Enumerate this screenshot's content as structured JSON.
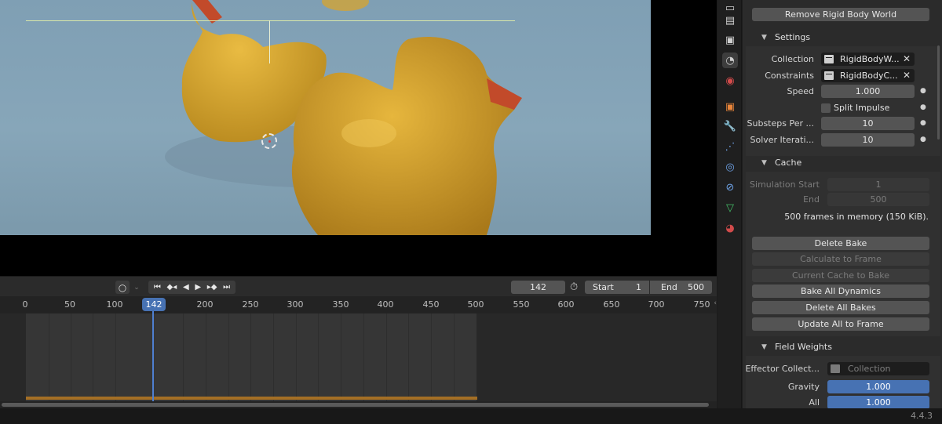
{
  "timeline": {
    "current_frame": "142",
    "frame_badge": "142",
    "start_label": "Start",
    "start_value": "1",
    "end_label": "End",
    "end_value": "500",
    "ruler_ticks": [
      "0",
      "50",
      "100",
      "200",
      "250",
      "300",
      "350",
      "400",
      "450",
      "500",
      "550",
      "600",
      "650",
      "700",
      "750"
    ],
    "playback_icons": [
      "jump-start-icon",
      "prev-keyframe-icon",
      "play-reverse-icon",
      "play-icon",
      "next-keyframe-icon",
      "jump-end-icon"
    ]
  },
  "tabs": [
    {
      "icon": "render-icon",
      "color": "#cfcfcf"
    },
    {
      "icon": "output-icon",
      "color": "#cfcfcf"
    },
    {
      "icon": "view-layer-icon",
      "color": "#cfcfcf"
    },
    {
      "icon": "scene-icon",
      "color": "#cfcfcf",
      "active": true
    },
    {
      "icon": "world-icon",
      "color": "#d24b4b"
    },
    {
      "icon": "object-icon",
      "color": "#e8853a"
    },
    {
      "icon": "modifier-icon",
      "color": "#6ea3e8"
    },
    {
      "icon": "particles-icon",
      "color": "#6ea3e8"
    },
    {
      "icon": "physics-icon",
      "color": "#6ea3e8"
    },
    {
      "icon": "constraints-icon",
      "color": "#6ea3e8"
    },
    {
      "icon": "data-icon",
      "color": "#45c26a"
    },
    {
      "icon": "material-icon",
      "color": "#d24b4b"
    }
  ],
  "panel": {
    "remove_button": "Remove Rigid Body World",
    "settings": {
      "title": "Settings",
      "collection_label": "Collection",
      "collection_value": "RigidBodyW...",
      "constraints_label": "Constraints",
      "constraints_value": "RigidBodyC...",
      "speed_label": "Speed",
      "speed_value": "1.000",
      "split_impulse_label": "Split Impulse",
      "substeps_label": "Substeps Per ...",
      "substeps_value": "10",
      "solver_label": "Solver Iterati...",
      "solver_value": "10"
    },
    "cache": {
      "title": "Cache",
      "sim_start_label": "Simulation Start",
      "sim_start_value": "1",
      "end_label": "End",
      "end_value": "500",
      "info": "500 frames in memory (150 KiB).",
      "delete_bake": "Delete Bake",
      "calculate_to_frame": "Calculate to Frame",
      "current_cache_to_bake": "Current Cache to Bake",
      "bake_all_dynamics": "Bake All Dynamics",
      "delete_all_bakes": "Delete All Bakes",
      "update_all_to_frame": "Update All to Frame"
    },
    "field_weights": {
      "title": "Field Weights",
      "effector_label": "Effector Collect...",
      "effector_placeholder": "Collection",
      "gravity_label": "Gravity",
      "gravity_value": "1.000",
      "all_label": "All",
      "all_value": "1.000"
    }
  },
  "status": {
    "version": "4.4.3"
  }
}
